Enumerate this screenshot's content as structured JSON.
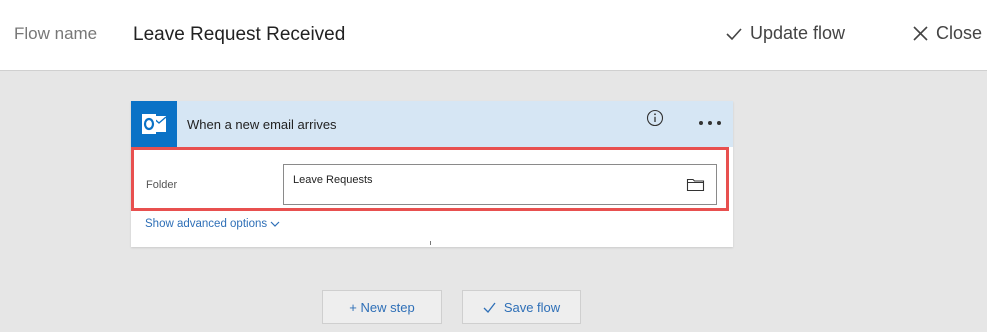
{
  "header": {
    "flow_name_label": "Flow name",
    "flow_name_value": "Leave Request Received",
    "update_flow_label": "Update flow",
    "close_label": "Close"
  },
  "trigger_card": {
    "title": "When a new email arrives",
    "connector_icon": "outlook-icon",
    "folder_label": "Folder",
    "folder_value": "Leave Requests",
    "show_advanced_label": "Show advanced options"
  },
  "actions": {
    "new_step_label": "+ New step",
    "save_flow_label": "Save flow"
  },
  "colors": {
    "header_bg": "#ffffff",
    "canvas_bg": "#e6e6e6",
    "card_header_bg": "#d6e6f4",
    "outlook_blue": "#0a72c6",
    "highlight_red": "#e8504f",
    "link_blue": "#2e6fb7"
  }
}
